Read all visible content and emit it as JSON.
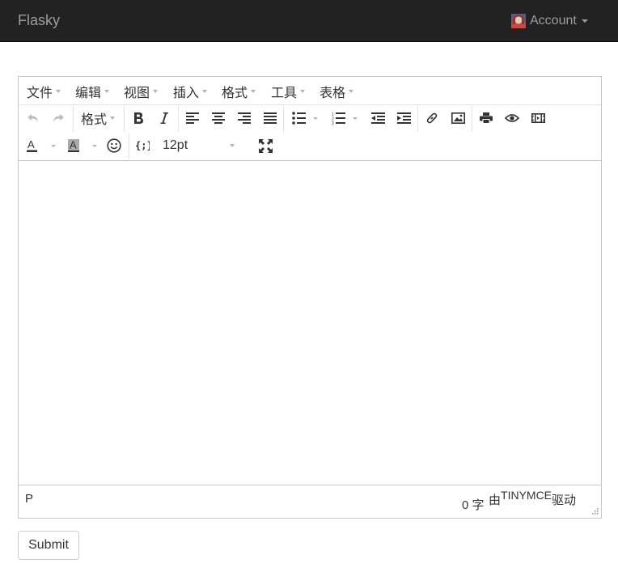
{
  "navbar": {
    "brand": "Flasky",
    "account_label": "Account"
  },
  "editor": {
    "menubar": [
      "文件",
      "编辑",
      "视图",
      "插入",
      "格式",
      "工具",
      "表格"
    ],
    "toolbar": {
      "format_label": "格式",
      "font_size": "12pt",
      "icons": [
        "undo-icon",
        "redo-icon",
        "bold-icon",
        "italic-icon",
        "align-left-icon",
        "align-center-icon",
        "align-right-icon",
        "align-justify-icon",
        "bullet-list-icon",
        "numbered-list-icon",
        "outdent-icon",
        "indent-icon",
        "link-icon",
        "image-icon",
        "print-icon",
        "preview-icon",
        "media-icon",
        "text-color-icon",
        "background-color-icon",
        "emoticon-icon",
        "code-icon",
        "fullscreen-icon"
      ]
    },
    "status": {
      "path": "P",
      "word_count": "0 字",
      "branding_prefix": "由",
      "branding_brand": "TINYMCE",
      "branding_suffix": "驱动"
    }
  },
  "form": {
    "submit_label": "Submit"
  }
}
